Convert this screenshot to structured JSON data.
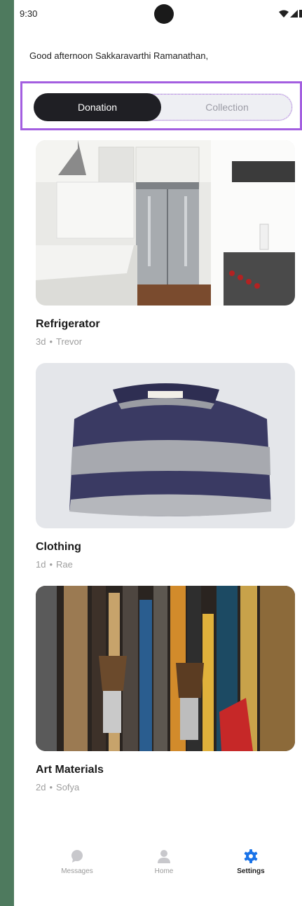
{
  "status_bar": {
    "time": "9:30"
  },
  "greeting": "Good afternoon Sakkaravarthi Ramanathan,",
  "tabs": [
    {
      "label": "Donation",
      "selected": true
    },
    {
      "label": "Collection",
      "selected": false
    }
  ],
  "items": [
    {
      "title": "Refrigerator",
      "age": "3d",
      "author": "Trevor",
      "image": "kitchen-photo"
    },
    {
      "title": "Clothing",
      "age": "1d",
      "author": "Rae",
      "image": "sweater-photo"
    },
    {
      "title": "Art Materials",
      "age": "2d",
      "author": "Sofya",
      "image": "brushes-photo"
    }
  ],
  "meta_separator": "•",
  "bottom_nav": [
    {
      "label": "Messages",
      "icon": "chat-bubble-icon",
      "active": false
    },
    {
      "label": "Home",
      "icon": "person-icon",
      "active": false
    },
    {
      "label": "Settings",
      "icon": "gear-icon",
      "active": true
    }
  ],
  "colors": {
    "accent": "#1a73e8",
    "toggle_active": "#1f1f24",
    "focus_outline": "#a35ee0"
  }
}
